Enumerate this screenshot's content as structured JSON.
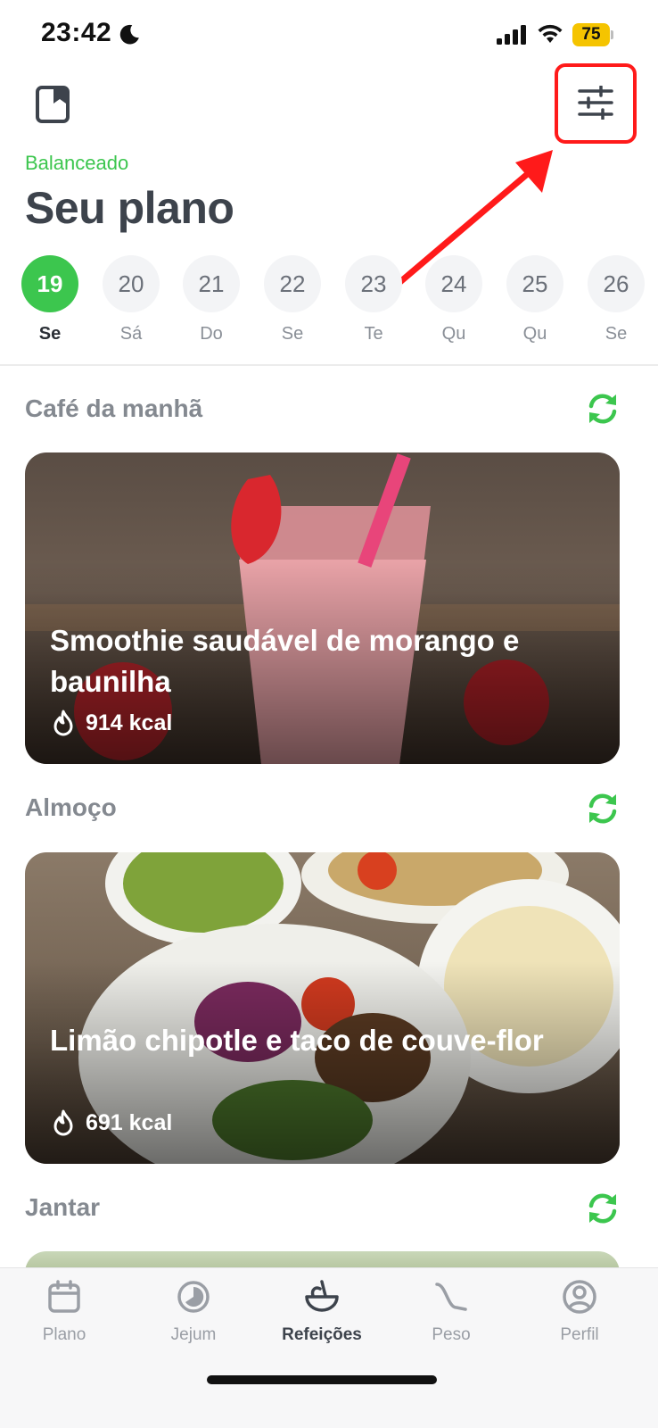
{
  "status_bar": {
    "time": "23:42",
    "battery": "75"
  },
  "header": {
    "plan_type": "Balanceado",
    "title": "Seu plano"
  },
  "days": [
    {
      "num": "19",
      "label": "Se",
      "selected": true
    },
    {
      "num": "20",
      "label": "Sá"
    },
    {
      "num": "21",
      "label": "Do"
    },
    {
      "num": "22",
      "label": "Se"
    },
    {
      "num": "23",
      "label": "Te"
    },
    {
      "num": "24",
      "label": "Qu"
    },
    {
      "num": "25",
      "label": "Qu"
    },
    {
      "num": "26",
      "label": "Se"
    }
  ],
  "meals": [
    {
      "section": "Café da manhã",
      "name": "Smoothie saudável de morango e baunilha",
      "kcal": "914 kcal"
    },
    {
      "section": "Almoço",
      "name": "Limão chipotle e taco de couve-flor",
      "kcal": "691 kcal"
    },
    {
      "section": "Jantar"
    }
  ],
  "tabs": [
    {
      "label": "Plano",
      "icon": "calendar-icon"
    },
    {
      "label": "Jejum",
      "icon": "fasting-clock-icon"
    },
    {
      "label": "Refeições",
      "icon": "bowl-icon",
      "active": true
    },
    {
      "label": "Peso",
      "icon": "weight-curve-icon"
    },
    {
      "label": "Perfil",
      "icon": "profile-icon"
    }
  ],
  "colors": {
    "accent": "#3cc64e",
    "annotation": "#ff1a1a",
    "battery": "#f5c400"
  }
}
